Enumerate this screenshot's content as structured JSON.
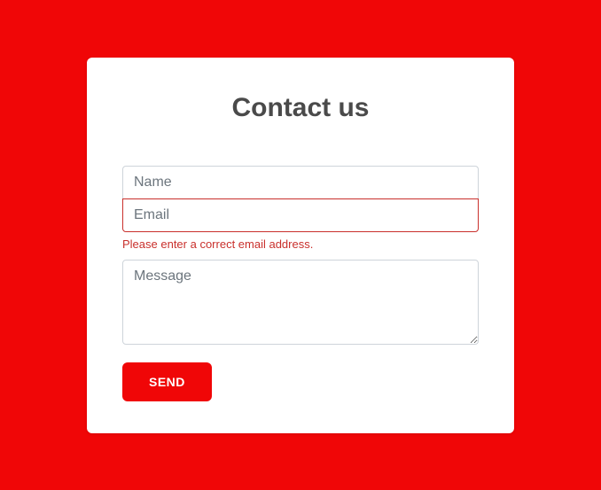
{
  "form": {
    "title": "Contact us",
    "name": {
      "placeholder": "Name",
      "value": ""
    },
    "email": {
      "placeholder": "Email",
      "value": "",
      "error": "Please enter a correct email address."
    },
    "message": {
      "placeholder": "Message",
      "value": ""
    },
    "submit_label": "SEND"
  },
  "colors": {
    "primary": "#f00607",
    "error": "#c9302c"
  }
}
